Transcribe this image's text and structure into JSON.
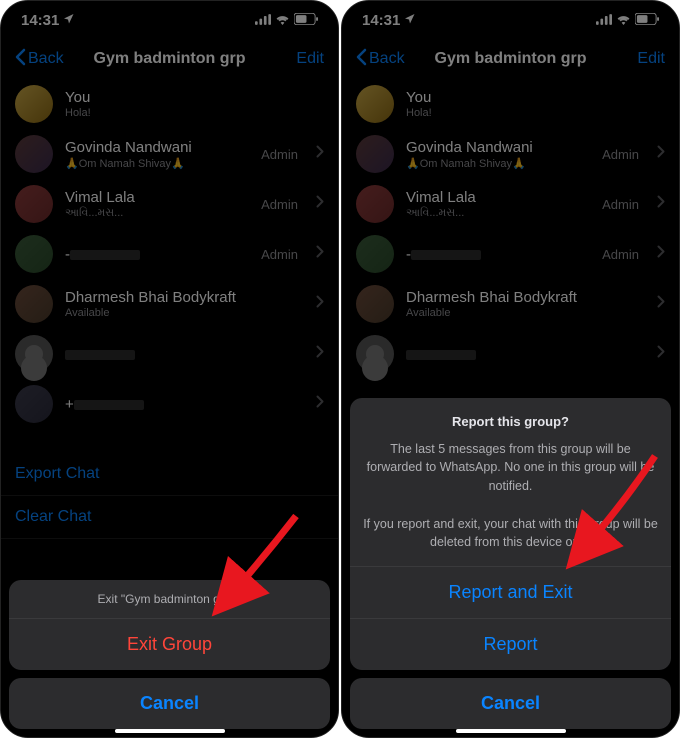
{
  "status": {
    "time": "14:31"
  },
  "nav": {
    "back": "Back",
    "title": "Gym badminton grp",
    "edit": "Edit"
  },
  "participants": [
    {
      "name": "You",
      "status": "Hola!",
      "admin": false,
      "avatar": "you",
      "chevron": false
    },
    {
      "name": "Govinda Nandwani",
      "status": "🙏Om Namah Shivay🙏",
      "admin": true,
      "avatar": "gn",
      "chevron": true
    },
    {
      "name": "Vimal Lala",
      "status": "આવિ...મસ...",
      "admin": true,
      "avatar": "vl",
      "chevron": true
    },
    {
      "name": "-",
      "status": "",
      "admin": true,
      "avatar": "p4",
      "chevron": true,
      "redact": true
    },
    {
      "name": "Dharmesh Bhai Bodykraft",
      "status": "Available",
      "admin": false,
      "avatar": "db",
      "chevron": true
    },
    {
      "name": "",
      "status": "",
      "admin": false,
      "avatar": "blank",
      "chevron": true,
      "redact": true
    },
    {
      "name": "+",
      "status": "",
      "admin": false,
      "avatar": "p7",
      "chevron": true,
      "redact": true
    }
  ],
  "actions": {
    "export": "Export Chat",
    "clear": "Clear Chat"
  },
  "sheet_left": {
    "prompt": "Exit \"Gym badminton grp\"?",
    "exit": "Exit Group",
    "cancel": "Cancel"
  },
  "sheet_right": {
    "title": "Report this group?",
    "body1": "The last 5 messages from this group will be forwarded to WhatsApp. No one in this group will be notified.",
    "body2": "If you report and exit, your chat with this group will be deleted from this device only.",
    "report_exit": "Report and Exit",
    "report": "Report",
    "cancel": "Cancel"
  }
}
